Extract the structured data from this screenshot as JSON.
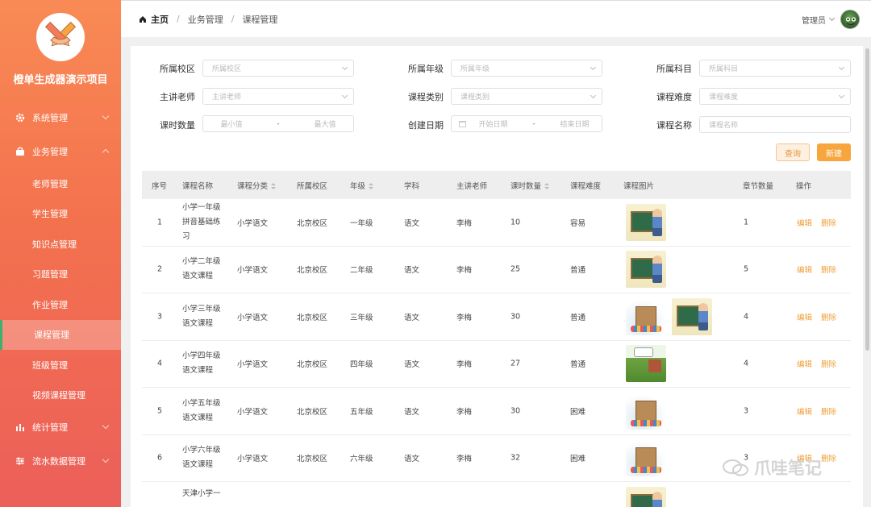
{
  "sidebar": {
    "title": "橙单生成器演示项目",
    "menus": [
      {
        "label": "系统管理",
        "icon": "gear-icon"
      },
      {
        "label": "业务管理",
        "icon": "bag-icon"
      },
      {
        "label": "统计管理",
        "icon": "bar-chart-icon"
      },
      {
        "label": "流水数据管理",
        "icon": "sliders-icon"
      }
    ],
    "sub_items": [
      "老师管理",
      "学生管理",
      "知识点管理",
      "习题管理",
      "作业管理",
      "课程管理",
      "班级管理",
      "视频课程管理"
    ],
    "active_sub": "课程管理"
  },
  "header": {
    "breadcrumb": [
      "主页",
      "业务管理",
      "课程管理"
    ],
    "user": "管理员"
  },
  "filters": {
    "campus_label": "所属校区",
    "campus_placeholder": "所属校区",
    "grade_label": "所属年级",
    "grade_placeholder": "所属年级",
    "subject_label": "所属科目",
    "subject_placeholder": "所属科目",
    "teacher_label": "主讲老师",
    "teacher_placeholder": "主讲老师",
    "type_label": "课程类别",
    "type_placeholder": "课程类别",
    "difficulty_label": "课程难度",
    "difficulty_placeholder": "课程难度",
    "hours_label": "课时数量",
    "hours_min": "最小值",
    "hours_max": "最大值",
    "date_label": "创建日期",
    "date_start": "开始日期",
    "date_end": "结束日期",
    "name_label": "课程名称",
    "name_placeholder": "课程名称",
    "sep": "-",
    "query_button": "查询",
    "new_button": "新建"
  },
  "table": {
    "headers": [
      "序号",
      "课程名称",
      "课程分类",
      "所属校区",
      "年级",
      "学科",
      "主讲老师",
      "课时数量",
      "课程难度",
      "课程图片",
      "章节数量",
      "操作"
    ],
    "edit_label": "编辑",
    "delete_label": "删除",
    "rows": [
      {
        "no": "1",
        "name": "小学一年级拼音基础练习",
        "category": "小学语文",
        "campus": "北京校区",
        "grade": "一年级",
        "subject": "语文",
        "teacher": "李梅",
        "hours": "10",
        "difficulty": "容易",
        "images": [
          "board"
        ],
        "chapters": "1"
      },
      {
        "no": "2",
        "name": "小学二年级语文课程",
        "category": "小学语文",
        "campus": "北京校区",
        "grade": "二年级",
        "subject": "语文",
        "teacher": "李梅",
        "hours": "25",
        "difficulty": "普通",
        "images": [
          "board"
        ],
        "chapters": "5"
      },
      {
        "no": "3",
        "name": "小学三年级语文课程",
        "category": "小学语文",
        "campus": "北京校区",
        "grade": "三年级",
        "subject": "语文",
        "teacher": "李梅",
        "hours": "30",
        "difficulty": "普通",
        "images": [
          "school",
          "board"
        ],
        "chapters": "4"
      },
      {
        "no": "4",
        "name": "小学四年级语文课程",
        "category": "小学语文",
        "campus": "北京校区",
        "grade": "四年级",
        "subject": "语文",
        "teacher": "李梅",
        "hours": "27",
        "difficulty": "普通",
        "images": [
          "garden"
        ],
        "chapters": "4"
      },
      {
        "no": "5",
        "name": "小学五年级语文课程",
        "category": "小学语文",
        "campus": "北京校区",
        "grade": "五年级",
        "subject": "语文",
        "teacher": "李梅",
        "hours": "30",
        "difficulty": "困难",
        "images": [
          "school"
        ],
        "chapters": "3"
      },
      {
        "no": "6",
        "name": "小学六年级语文课程",
        "category": "小学语文",
        "campus": "北京校区",
        "grade": "六年级",
        "subject": "语文",
        "teacher": "李梅",
        "hours": "32",
        "difficulty": "困难",
        "images": [
          "school"
        ],
        "chapters": "3"
      },
      {
        "no": "",
        "name": "天津小学一",
        "category": "",
        "campus": "",
        "grade": "",
        "subject": "",
        "teacher": "",
        "hours": "",
        "difficulty": "",
        "images": [
          "board"
        ],
        "chapters": ""
      }
    ]
  },
  "watermark": "爪哇笔记",
  "colors": {
    "accent": "#f7a63d",
    "sidebar_top": "#f98a55",
    "sidebar_bottom": "#ec5f5a",
    "active_marker": "#3fb06b"
  }
}
